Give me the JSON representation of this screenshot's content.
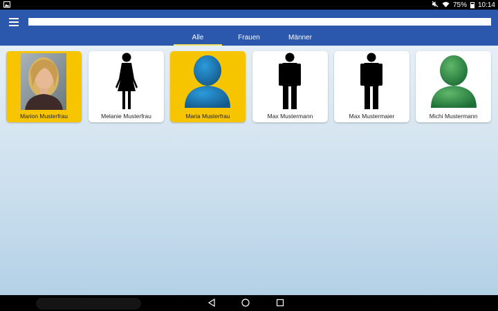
{
  "status": {
    "battery_percent": "75%",
    "time": "10:14",
    "icons": [
      "gallery-icon",
      "mute-icon",
      "wifi-icon",
      "battery-icon"
    ]
  },
  "app_bar": {
    "menu_icon": "hamburger-icon",
    "search": {
      "value": "",
      "placeholder": ""
    },
    "accent_color": "#2b57ad",
    "active_tab_underline": "#f2e35a"
  },
  "tabs": [
    {
      "label": "Alle",
      "active": true
    },
    {
      "label": "Frauen",
      "active": false
    },
    {
      "label": "Männer",
      "active": false
    }
  ],
  "contacts": [
    {
      "name": "Marion Musterfrau",
      "avatar": "photo",
      "highlighted": true
    },
    {
      "name": "Melanie Musterfrau",
      "avatar": "female-figure-icon",
      "highlighted": false
    },
    {
      "name": "Maria Musterfrau",
      "avatar": "blue-person-silhouette-icon",
      "highlighted": true
    },
    {
      "name": "Max Mustermann",
      "avatar": "male-figure-icon",
      "highlighted": false
    },
    {
      "name": "Max Mustermaier",
      "avatar": "male-figure-icon",
      "highlighted": false
    },
    {
      "name": "Michi Mustermann",
      "avatar": "green-person-silhouette-icon",
      "highlighted": false
    }
  ],
  "highlight_color": "#f7c500",
  "nav": {
    "icons": [
      "back-icon",
      "home-icon",
      "recents-icon"
    ]
  }
}
